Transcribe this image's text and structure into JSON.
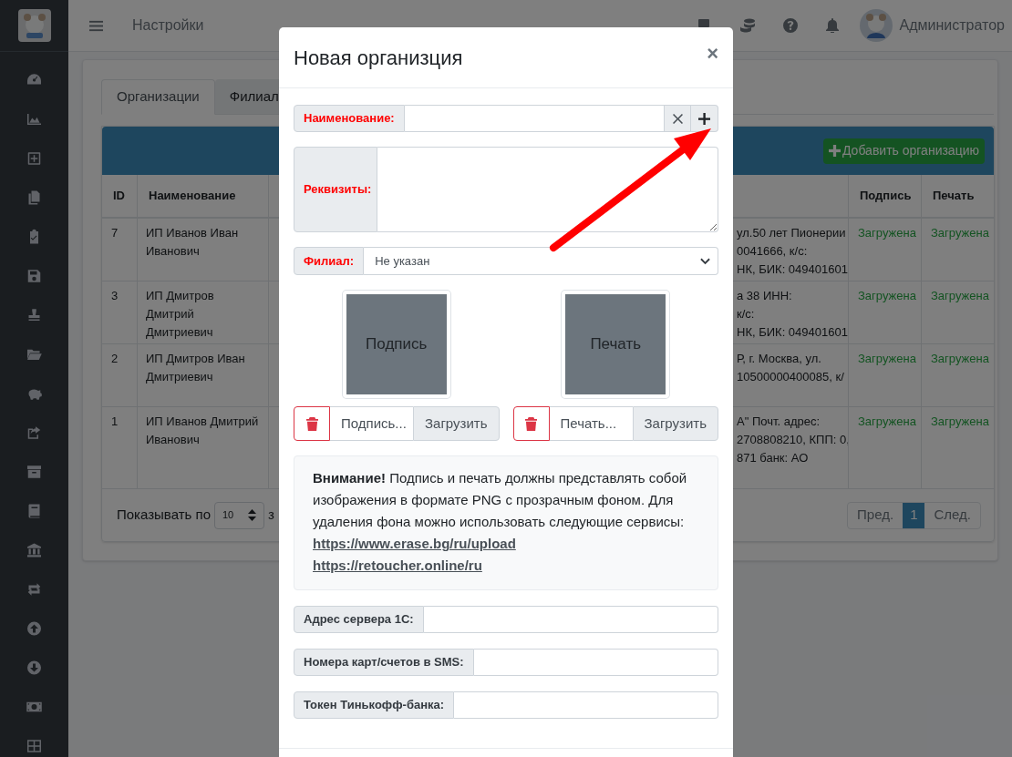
{
  "topbar": {
    "page_title": "Настройки",
    "user": "Администратор"
  },
  "tabs": [
    {
      "label": "Организации",
      "selected": true
    },
    {
      "label": "Филиал",
      "selected": false
    }
  ],
  "card": {
    "add_button": "Добавить организацию"
  },
  "table": {
    "columns": [
      "ID",
      "Наименование",
      "Подпись",
      "Печать"
    ],
    "rows": [
      {
        "id": "7",
        "name": "ИП Иванов Иван Иванович",
        "details": [
          "ул.50 лет Пионерии",
          "0041666, к/с:",
          "НК, БИК: 049401601"
        ],
        "signature": "Загружена",
        "stamp": "Загружена"
      },
      {
        "id": "3",
        "name": "ИП Дмитров Дмитрий Дмитриевич",
        "details": [
          "а 38 ИНН:",
          "к/с:",
          "НК, БИК: 049401601"
        ],
        "signature": "Загружена",
        "stamp": "Загружена"
      },
      {
        "id": "2",
        "name": "ИП Дмитров Иван Дмитриевич",
        "details": [
          "Р, г. Москва, ул.",
          "10500000400085, к/"
        ],
        "signature": "Загружена",
        "stamp": "Загружена"
      },
      {
        "id": "1",
        "name": "ИП Иванов Дмитрий Иванович",
        "details": [
          "А\" Почт. адрес:",
          "2708808210, КПП: 0,",
          "871 банк: АО"
        ],
        "signature": "Загружена",
        "stamp": "Загружена"
      }
    ]
  },
  "footer": {
    "show_label": "Показывать по",
    "page_size": "10",
    "after": "з",
    "prev": "Пред.",
    "pages": [
      {
        "label": "1",
        "selected": true
      }
    ],
    "next": "След."
  },
  "modal": {
    "title": "Новая организция",
    "close": "×",
    "fields": [
      {
        "kind": "input",
        "label": "Наименование:",
        "required": true,
        "clearable": true,
        "addable": true
      },
      {
        "kind": "textarea",
        "label": "Реквизиты:",
        "required": true
      },
      {
        "kind": "select",
        "label": "Филиал:",
        "required": true,
        "value": "Не указан"
      }
    ],
    "images": [
      {
        "preview": "Подпись",
        "file": "Подпись...",
        "upload": "Загрузить"
      },
      {
        "preview": "Печать",
        "file": "Печать...",
        "upload": "Загрузить"
      }
    ],
    "notice": {
      "text": "**Внимание!** Подпись и печать должны представлять собой изображения в формате PNG с прозрачным фоном. Для удаления фона можно использовать следующие сервисы:",
      "links": [
        "https://www.erase.bg/ru/upload",
        "https://retoucher.online/ru"
      ]
    },
    "extra_fields": [
      {
        "kind": "input",
        "label": "Адрес сервера 1С:",
        "required": false
      },
      {
        "kind": "input",
        "label": "Номера карт/счетов в SMS:",
        "required": false
      },
      {
        "kind": "input",
        "label": "Токен Тинькофф-банка:",
        "required": false
      }
    ]
  }
}
